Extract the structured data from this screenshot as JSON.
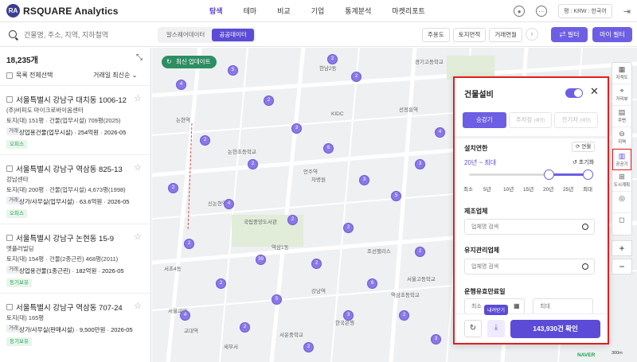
{
  "app": {
    "logo_badge": "RA",
    "name": "RSQUARE Analytics"
  },
  "nav": [
    "탐색",
    "테마",
    "비교",
    "기업",
    "통계분석",
    "마켓리포트"
  ],
  "header": {
    "locale": "평 : KRW : 한국어"
  },
  "search": {
    "placeholder": "건물명, 주소, 지역, 지하철역"
  },
  "data_toggle": {
    "left": "알스퀘어데이터",
    "right": "공공데이터"
  },
  "filter_chips": [
    "주용도",
    "토지면적",
    "거래연월"
  ],
  "buttons": {
    "filter": "⇄ 필터",
    "my_filter": "마이 필터"
  },
  "list": {
    "count": "18,235개",
    "select_all": "목록 전체선택",
    "sort": "거래일 최신순 ⌄",
    "items": [
      {
        "title": "서울특별시 강남구 대치동 1006-12",
        "name": "(주)비피도 마이크로바이옴센터",
        "area": "토지(대) 151평 · 건물(업무시설) 709평(2025)",
        "tag": "거래",
        "use": "상업용건물(업무시설) · 254억원 · 2026-05",
        "badge": "오피스"
      },
      {
        "title": "서울특별시 강남구 역삼동 825-13",
        "name": "강남센타",
        "area": "토지(대) 200평 · 건물(업무시설) 4,673평(1998)",
        "tag": "거래",
        "use": "상가/사무실(업무시설) · 63.6억원 · 2026-05",
        "badge": "오피스"
      },
      {
        "title": "서울특별시 강남구 논현동 15-9",
        "name": "엣플러빌딩",
        "area": "토지(대) 154평 · 건물(2종근린) 468평(2011)",
        "tag": "거래",
        "use": "상업용건물(1종근린) · 182억원 · 2026-05",
        "badge": "동기보유"
      },
      {
        "title": "서울특별시 강남구 역삼동 707-24",
        "name": "",
        "area": "토지(대) 165평",
        "tag": "거래",
        "use": "상가/사무실(판매시설) · 9,500만원 · 2026-05",
        "badge": "동기보유"
      }
    ]
  },
  "map": {
    "update_button": "최신 업데이트",
    "labels": [
      "한남2동",
      "경기고등학교",
      "논현역",
      "선정릉역",
      "신논현역",
      "국립중앙도서관",
      "서초4동",
      "역삼1동",
      "강남역",
      "조선팰리스",
      "서울고등학교",
      "KIDC",
      "차병원",
      "논현초등학교",
      "한국은행",
      "언주역",
      "서운중학교",
      "역삼초등학교",
      "서울교대",
      "세무서",
      "교대역"
    ],
    "markers": [
      "2",
      "2",
      "4",
      "5",
      "2",
      "3",
      "2",
      "2",
      "6",
      "3",
      "2",
      "39",
      "4",
      "2",
      "2",
      "5",
      "3",
      "4",
      "2",
      "2",
      "6",
      "2",
      "2",
      "5",
      "3",
      "2",
      "4",
      "2",
      "2",
      "3"
    ],
    "scale": "300m",
    "provider": "NAVER"
  },
  "right_toolbar": [
    "지적도",
    "거리뷰",
    "주변",
    "지역",
    "공공기",
    "도시계획"
  ],
  "panel": {
    "title": "건물설비",
    "tabs": [
      {
        "label": "승강기",
        "note": ""
      },
      {
        "label": "주차장",
        "note": "(예정)"
      },
      {
        "label": "전기차",
        "note": "(예정)"
      }
    ],
    "install_label": "설치연한",
    "chip": "⟳ 연월",
    "range_text": "20년 ~ 최대",
    "reset": "↺ 초기화",
    "ticks": [
      "최소",
      "5년",
      "10년",
      "15년",
      "20년",
      "25년",
      "최대"
    ],
    "slider": {
      "min_index": 4,
      "max_index": 6,
      "steps": 6
    },
    "maker_label": "제조업체",
    "maker_placeholder": "업체명 검색",
    "maint_label": "유지관리업체",
    "maint_placeholder": "업체명 검색",
    "expiry_label": "운행유효만료일",
    "date_from_placeholder": "최소",
    "date_to_placeholder": "최대",
    "download_tooltip": "내려받기",
    "confirm": "143,930건 확인"
  },
  "colors": {
    "accent": "#5b4bd6",
    "marker": "#8b78e6",
    "highlight_border": "#e02020",
    "update_green": "#2d8e62"
  }
}
